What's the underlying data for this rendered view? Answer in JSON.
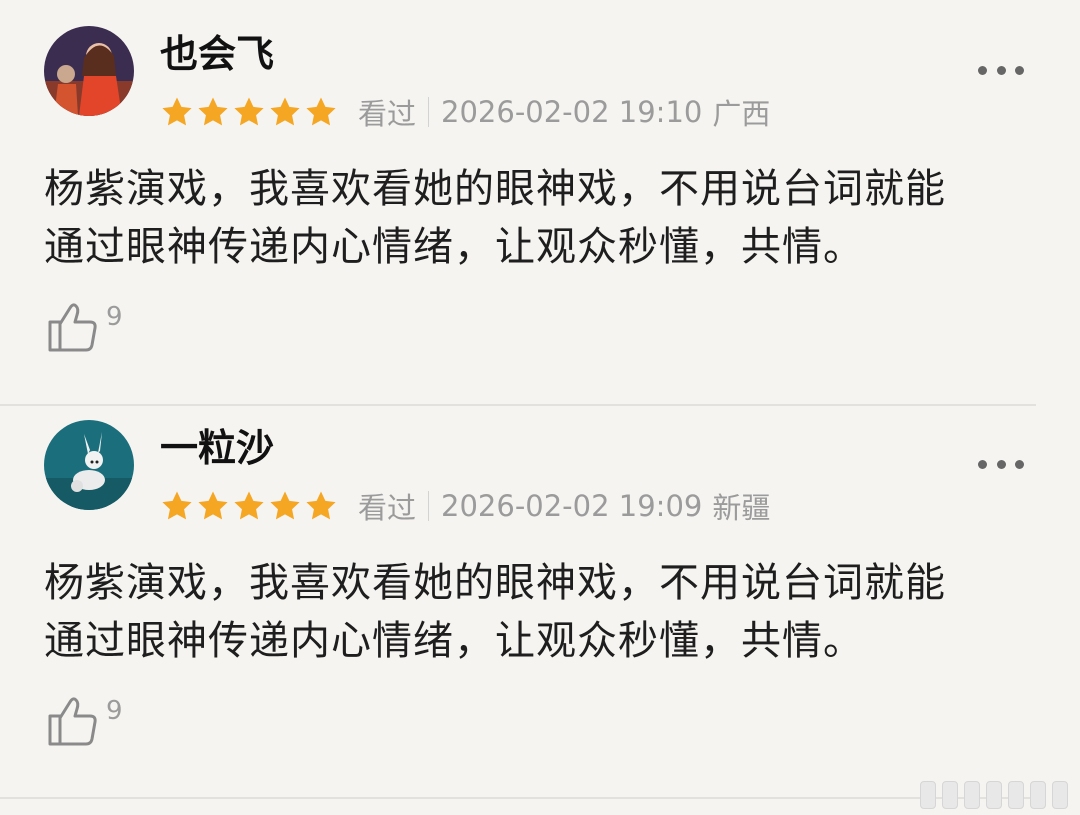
{
  "reviews": [
    {
      "username": "也会飞",
      "rating": 5,
      "watched": "看过",
      "datetime": "2026-02-02 19:10",
      "region": "广西",
      "content_line1": "杨紫演戏，我喜欢看她的眼神戏，不用说台词就能",
      "content_line2": "通过眼神传递内心情绪，让观众秒懂，共情。",
      "likes": "9"
    },
    {
      "username": "一粒沙",
      "rating": 5,
      "watched": "看过",
      "datetime": "2026-02-02 19:09",
      "region": "新疆",
      "content_line1": "杨紫演戏，我喜欢看她的眼神戏，不用说台词就能",
      "content_line2": "通过眼神传递内心情绪，让观众秒懂，共情。",
      "likes": "9"
    }
  ],
  "colors": {
    "star": "#f5a623",
    "meta_text": "#9b9b9b",
    "background": "#f6f4f1"
  },
  "icons": {
    "more": "more-icon",
    "like": "thumbs-up-icon",
    "star": "star-icon"
  }
}
